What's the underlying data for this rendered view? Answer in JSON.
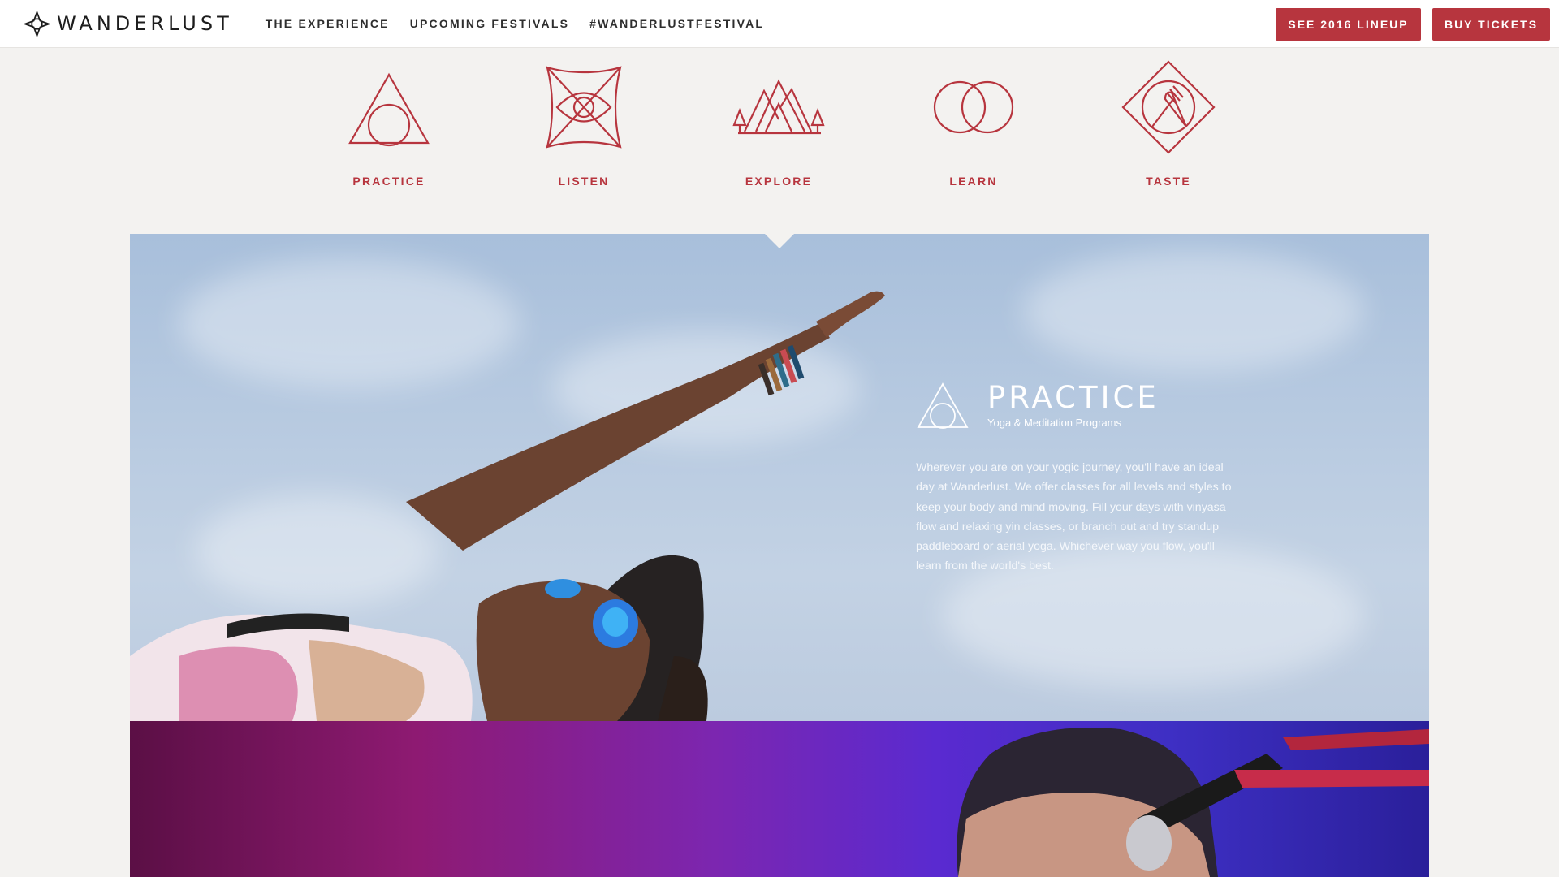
{
  "header": {
    "logo_text": "WANDERLUST",
    "nav": [
      "THE EXPERIENCE",
      "UPCOMING FESTIVALS",
      "#WANDERLUSTFESTIVAL"
    ],
    "lineup_button": "SEE 2016 LINEUP",
    "tickets_button": "BUY TICKETS"
  },
  "experiences": [
    {
      "label": "PRACTICE",
      "icon": "triangle-circle-icon"
    },
    {
      "label": "LISTEN",
      "icon": "eye-icon"
    },
    {
      "label": "EXPLORE",
      "icon": "mountains-icon"
    },
    {
      "label": "LEARN",
      "icon": "interlocking-circles-icon"
    },
    {
      "label": "TASTE",
      "icon": "fork-knife-diamond-icon"
    }
  ],
  "feature": {
    "title": "PRACTICE",
    "subtitle": "Yoga & Meditation Programs",
    "body": "Wherever you are on your yogic journey, you'll have an ideal day at Wanderlust. We offer classes for all levels and styles to keep your body and mind moving. Fill your days with vinyasa flow and relaxing yin classes, or branch out and try standup paddleboard or aerial yoga. Whichever way you flow, you'll learn from the world's best."
  },
  "colors": {
    "accent": "#b7353e",
    "background": "#f3f2f0",
    "sky": "#b6c9e0"
  }
}
